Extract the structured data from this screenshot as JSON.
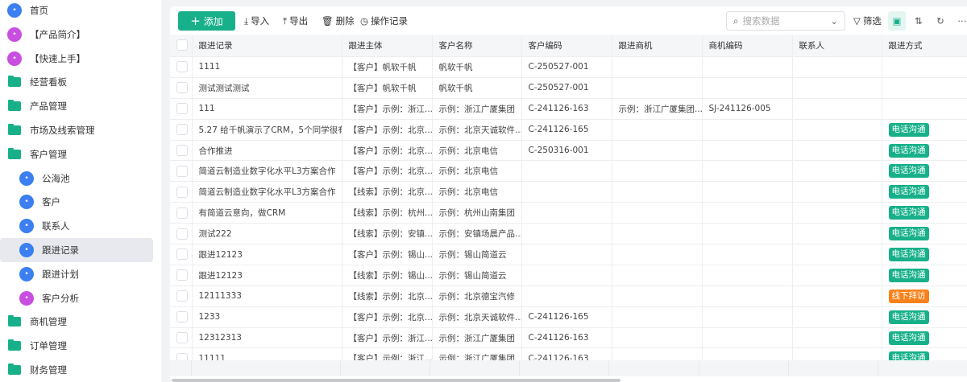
{
  "sidebar": {
    "items": [
      {
        "label": "首页",
        "icon": "home-icon",
        "type": "circle",
        "color": "#3b7ff0",
        "indent": 0
      },
      {
        "label": "【产品简介】",
        "icon": "tag-icon",
        "type": "circle",
        "color": "#c84fe0",
        "indent": 0
      },
      {
        "label": "【快速上手】",
        "icon": "send-icon",
        "type": "circle",
        "color": "#c84fe0",
        "indent": 0
      },
      {
        "label": "经营看板",
        "icon": "folder-icon",
        "type": "folder",
        "indent": 0
      },
      {
        "label": "产品管理",
        "icon": "folder-icon",
        "type": "folder",
        "indent": 0
      },
      {
        "label": "市场及线索管理",
        "icon": "folder-icon",
        "type": "folder",
        "indent": 0
      },
      {
        "label": "客户管理",
        "icon": "folder-open-icon",
        "type": "folder",
        "indent": 0
      },
      {
        "label": "公海池",
        "icon": "user-pool-icon",
        "type": "circle",
        "color": "#3b7ff0",
        "indent": 1
      },
      {
        "label": "客户",
        "icon": "user-icon",
        "type": "circle",
        "color": "#3b7ff0",
        "indent": 1
      },
      {
        "label": "联系人",
        "icon": "contact-book-icon",
        "type": "circle",
        "color": "#3b7ff0",
        "indent": 1
      },
      {
        "label": "跟进记录",
        "icon": "record-icon",
        "type": "circle",
        "color": "#3b7ff0",
        "indent": 1,
        "selected": true
      },
      {
        "label": "跟进计划",
        "icon": "calendar-icon",
        "type": "circle",
        "color": "#3b7ff0",
        "indent": 1
      },
      {
        "label": "客户分析",
        "icon": "chart-icon",
        "type": "circle",
        "color": "#c84fe0",
        "indent": 1
      },
      {
        "label": "商机管理",
        "icon": "folder-icon",
        "type": "folder",
        "indent": 0
      },
      {
        "label": "订单管理",
        "icon": "folder-icon",
        "type": "folder",
        "indent": 0
      },
      {
        "label": "财务管理",
        "icon": "folder-icon",
        "type": "folder",
        "indent": 0
      }
    ]
  },
  "toolbar": {
    "add": "添加",
    "import": "导入",
    "export": "导出",
    "delete": "删除",
    "log": "操作记录",
    "search_placeholder": "搜索数据",
    "filter": "筛选"
  },
  "table": {
    "columns": [
      "跟进记录",
      "跟进主体",
      "客户名称",
      "客户编码",
      "跟进商机",
      "商机编码",
      "联系人",
      "跟进方式"
    ],
    "rows": [
      [
        "1111",
        "【客户】帆软千帆",
        "帆软千帆",
        "C-250527-001",
        "",
        "",
        "",
        ""
      ],
      [
        "测试测试测试",
        "【客户】帆软千帆",
        "帆软千帆",
        "C-250527-001",
        "",
        "",
        "",
        ""
      ],
      [
        "111",
        "【客户】示例：浙江...",
        "示例：浙江广厦集团",
        "C-241126-163",
        "示例：浙江广厦集团...",
        "SJ-241126-005",
        "",
        ""
      ],
      [
        "5.27 给千帆演示了CRM，5个同学很有...",
        "【客户】示例：北京...",
        "示例：北京天诚软件...",
        "C-241126-165",
        "",
        "",
        "",
        "电话沟通"
      ],
      [
        "合作推进",
        "【客户】示例：北京...",
        "示例：北京电信",
        "C-250316-001",
        "",
        "",
        "",
        "电话沟通"
      ],
      [
        "简道云制造业数字化水平L3方案合作",
        "【客户】示例：北京...",
        "示例：北京电信",
        "",
        "",
        "",
        "",
        "电话沟通"
      ],
      [
        "简道云制造业数字化水平L3方案合作",
        "【线索】示例：北京...",
        "示例：北京电信",
        "",
        "",
        "",
        "",
        "电话沟通"
      ],
      [
        "有简道云意向，做CRM",
        "【线索】示例：杭州...",
        "示例：杭州山南集团",
        "",
        "",
        "",
        "",
        "电话沟通"
      ],
      [
        "测试222",
        "【线索】示例：安镇...",
        "示例：安镇场晨产品...",
        "",
        "",
        "",
        "",
        "电话沟通"
      ],
      [
        "跟进12123",
        "【客户】示例：锡山...",
        "示例：锡山简道云",
        "",
        "",
        "",
        "",
        "电话沟通"
      ],
      [
        "跟进12123",
        "【线索】示例：锡山...",
        "示例：锡山简道云",
        "",
        "",
        "",
        "",
        "电话沟通"
      ],
      [
        "12111333",
        "【线索】示例：北京...",
        "示例：北京德宝汽修",
        "",
        "",
        "",
        "",
        "线下拜访"
      ],
      [
        "1233",
        "【客户】示例：北京...",
        "示例：北京天诚软件...",
        "C-241126-165",
        "",
        "",
        "",
        "电话沟通"
      ],
      [
        "12312313",
        "【客户】示例：浙江...",
        "示例：浙江广厦集团",
        "C-241126-163",
        "",
        "",
        "",
        "电话沟通"
      ],
      [
        "11111",
        "【客户】示例：浙江...",
        "示例：浙江广厦集团",
        "C-241126-163",
        "",
        "",
        "",
        "电话沟通"
      ]
    ]
  },
  "tag_colors": {
    "电话沟通": "#17b08a",
    "线下拜访": "#f7821b"
  }
}
